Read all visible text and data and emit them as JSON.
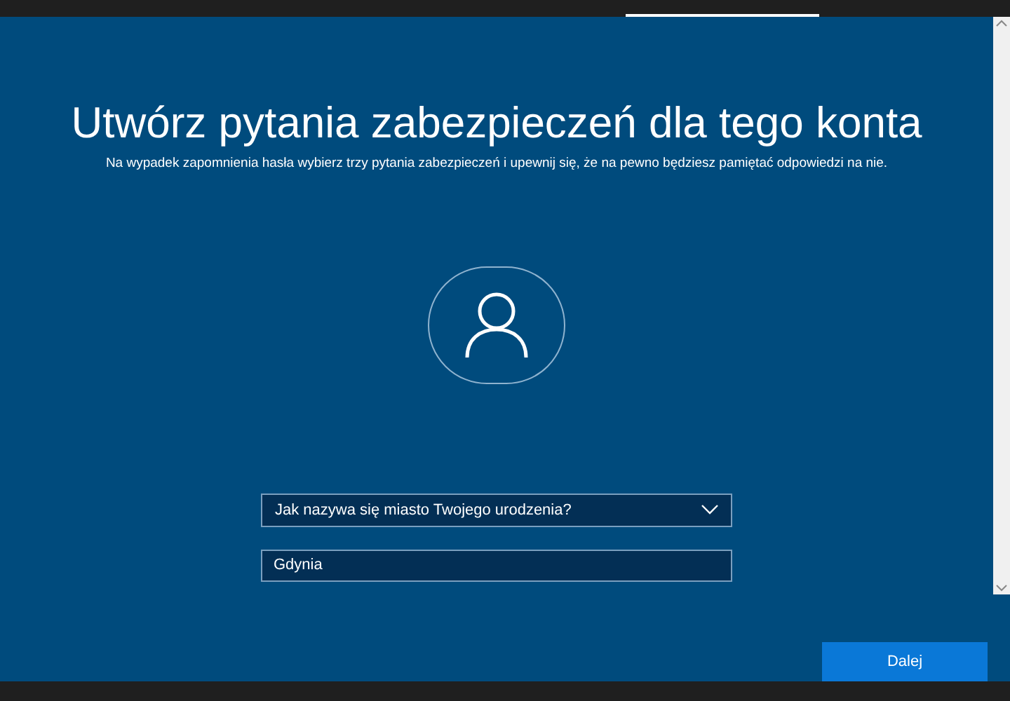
{
  "title": "Utwórz pytania zabezpieczeń dla tego konta",
  "subtitle": "Na wypadek zapomnienia hasła wybierz trzy pytania zabezpieczeń i upewnij się, że na pewno będziesz pamiętać odpowiedzi na nie.",
  "question_select": {
    "value": "Jak nazywa się miasto Twojego urodzenia?"
  },
  "answer_field": {
    "value": "Gdynia"
  },
  "next_button": {
    "label": "Dalej"
  }
}
